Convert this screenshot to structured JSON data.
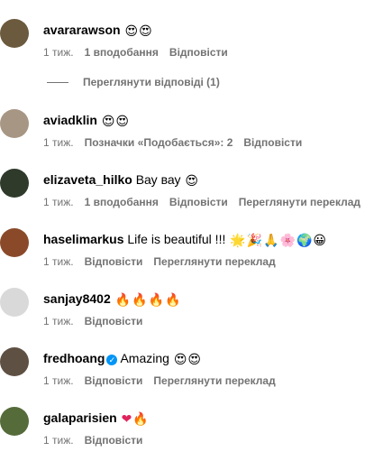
{
  "comments": [
    {
      "username": "avararawson",
      "text": "",
      "emojis": [
        "😍",
        "😍"
      ],
      "time": "1 тиж.",
      "likes": "1 вподобання",
      "reply": "Відповісти",
      "avatar_color": "#6b5a3d"
    },
    {
      "username": "aviadklin",
      "text": "",
      "emojis": [
        "😍",
        "😍"
      ],
      "time": "1 тиж.",
      "likes": "Позначки «Подобається»: 2",
      "reply": "Відповісти",
      "avatar_color": "#a79683"
    },
    {
      "username": "elizaveta_hilko",
      "text": "Вау вау",
      "emojis": [
        "😍"
      ],
      "time": "1 тиж.",
      "likes": "1 вподобання",
      "reply": "Відповісти",
      "translate": "Переглянути переклад",
      "avatar_color": "#2f3a2a"
    },
    {
      "username": "haselimarkus",
      "text": "Life is beautiful !!!",
      "emojis": [
        "🌟",
        "🎉",
        "🙏",
        "🌸",
        "🌍",
        "😀"
      ],
      "time": "1 тиж.",
      "reply": "Відповісти",
      "translate": "Переглянути переклад",
      "avatar_color": "#8a4a2a"
    },
    {
      "username": "sanjay8402",
      "text": "",
      "emojis": [
        "🔥",
        "🔥",
        "🔥",
        "🔥"
      ],
      "time": "1 тиж.",
      "reply": "Відповісти",
      "avatar_color": "#d9d9d9"
    },
    {
      "username": "fredhoang",
      "text": "Amazing",
      "emojis": [
        "😍",
        "😍"
      ],
      "time": "1 тиж.",
      "reply": "Відповісти",
      "translate": "Переглянути переклад",
      "verified": true,
      "avatar_color": "#5e5043"
    },
    {
      "username": "galaparisien",
      "text": "",
      "emojis": [
        "❤",
        "🔥"
      ],
      "time": "1 тиж.",
      "reply": "Відповісти",
      "avatar_color": "#556b3a"
    }
  ],
  "view_replies": "Переглянути відповіді (1)",
  "colors": {
    "meta_gray": "#737373",
    "verified_blue": "#0095f6"
  }
}
